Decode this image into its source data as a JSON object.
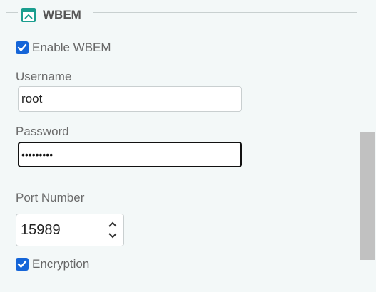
{
  "section": {
    "title": "WBEM",
    "collapse_icon": "collapse-panel-icon"
  },
  "enable": {
    "label": "Enable WBEM",
    "checked": true
  },
  "username": {
    "label": "Username",
    "value": "root"
  },
  "password": {
    "label": "Password",
    "masked_value": "•••••••••"
  },
  "port": {
    "label": "Port Number",
    "value": "15989",
    "increment_icon": "chevron-up-icon",
    "decrement_icon": "chevron-down-icon"
  },
  "encryption": {
    "label": "Encryption",
    "checked": true
  },
  "colors": {
    "accent": "#1a9e8f",
    "checkbox": "#1565d8",
    "background": "#f3f8f8",
    "scrollbar_thumb": "#c1c1c1"
  }
}
